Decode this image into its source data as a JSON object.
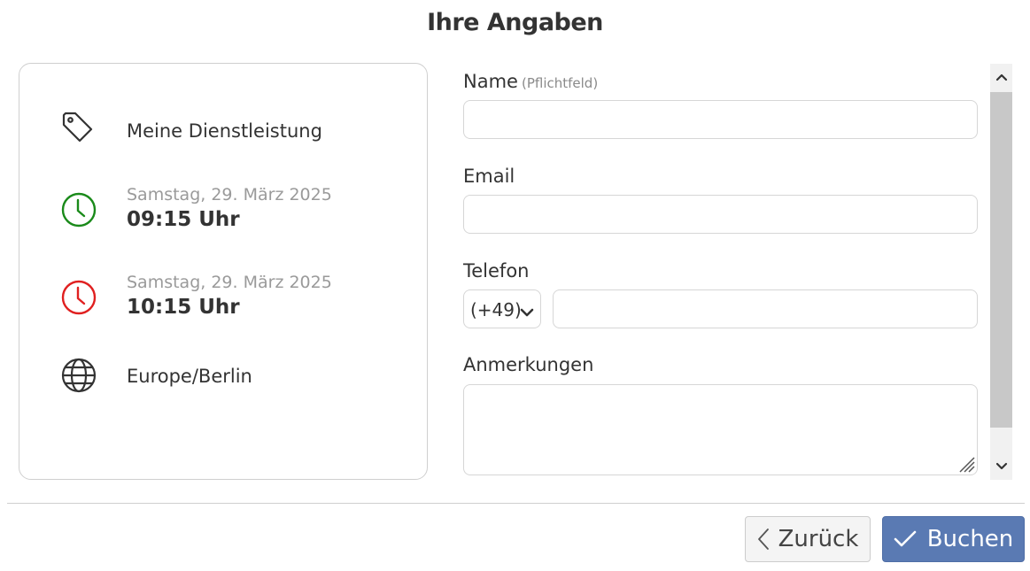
{
  "header": {
    "title": "Ihre Angaben"
  },
  "summary": {
    "service": {
      "icon": "tag-icon",
      "label": "Meine Dienstleistung"
    },
    "start": {
      "icon": "clock-icon",
      "color": "#1a8a1a",
      "date": "Samstag, 29. März 2025",
      "time": "09:15 Uhr"
    },
    "end": {
      "icon": "clock-icon",
      "color": "#e02020",
      "date": "Samstag, 29. März 2025",
      "time": "10:15 Uhr"
    },
    "timezone": {
      "icon": "globe-icon",
      "label": "Europe/Berlin"
    }
  },
  "form": {
    "name": {
      "label": "Name",
      "hint": "(Pflichtfeld)",
      "value": "",
      "placeholder": ""
    },
    "email": {
      "label": "Email",
      "value": "",
      "placeholder": ""
    },
    "phone": {
      "label": "Telefon",
      "country_code": "(+49)",
      "value": "",
      "placeholder": ""
    },
    "notes": {
      "label": "Anmerkungen",
      "value": "",
      "placeholder": ""
    }
  },
  "actions": {
    "back_label": "Zurück",
    "book_label": "Buchen",
    "book_color": "#5a7ab3"
  }
}
